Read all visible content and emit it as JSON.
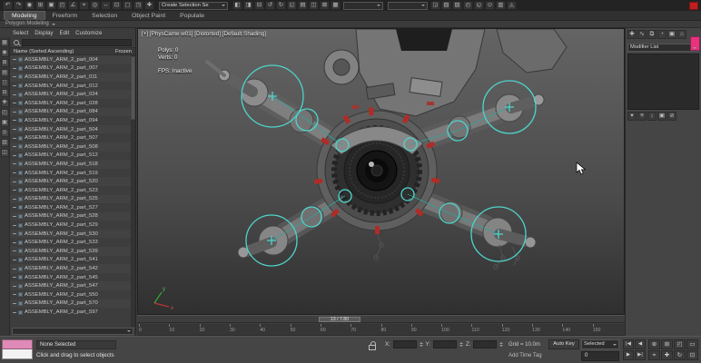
{
  "titlebar": {
    "icons_left": [
      "↶",
      "↷",
      "◉",
      "⊞",
      "▣",
      "◰",
      "∠",
      "⌖",
      "◎",
      "↔",
      "⊡",
      "▢",
      "◳",
      "✚"
    ],
    "selection_set": "Create Selection Se",
    "icons_mid": [
      "◧",
      "◨",
      "⊟",
      "↺",
      "↻",
      "◱",
      "▤",
      "◫",
      "⊠",
      "▦"
    ],
    "combo1": "",
    "combo2": "",
    "icons_right": [
      "◲",
      "▧",
      "▨",
      "◴",
      "◵",
      "⊙",
      "▥",
      "◬"
    ]
  },
  "ribbon": {
    "tabs": [
      "Modeling",
      "Freeform",
      "Selection",
      "Object Paint",
      "Populate"
    ],
    "panel_label": "Polygon Modeling"
  },
  "scene_explorer": {
    "menu": [
      "Select",
      "Display",
      "Edit",
      "Customize"
    ],
    "header_name": "Name (Sorted Ascending)",
    "header_frozen": "Frozen",
    "side_icons": [
      "▦",
      "◉",
      "⊞",
      "▤",
      "◻",
      "⊟",
      "✚",
      "◰",
      "▣",
      "◎",
      "▥",
      "◫"
    ],
    "rows": [
      "ASSEMBLY_ARM_2_part_004",
      "ASSEMBLY_ARM_2_part_007",
      "ASSEMBLY_ARM_2_part_011",
      "ASSEMBLY_ARM_2_part_012",
      "ASSEMBLY_ARM_2_part_024",
      "ASSEMBLY_ARM_2_part_028",
      "ASSEMBLY_ARM_2_part_084",
      "ASSEMBLY_ARM_2_part_094",
      "ASSEMBLY_ARM_2_part_504",
      "ASSEMBLY_ARM_2_part_507",
      "ASSEMBLY_ARM_2_part_508",
      "ASSEMBLY_ARM_2_part_512",
      "ASSEMBLY_ARM_2_part_518",
      "ASSEMBLY_ARM_2_part_519",
      "ASSEMBLY_ARM_2_part_520",
      "ASSEMBLY_ARM_2_part_523",
      "ASSEMBLY_ARM_2_part_525",
      "ASSEMBLY_ARM_2_part_527",
      "ASSEMBLY_ARM_2_part_528",
      "ASSEMBLY_ARM_2_part_529",
      "ASSEMBLY_ARM_2_part_530",
      "ASSEMBLY_ARM_2_part_533",
      "ASSEMBLY_ARM_2_part_539",
      "ASSEMBLY_ARM_2_part_541",
      "ASSEMBLY_ARM_2_part_542",
      "ASSEMBLY_ARM_2_part_545",
      "ASSEMBLY_ARM_2_part_547",
      "ASSEMBLY_ARM_2_part_550",
      "ASSEMBLY_ARM_2_part_570",
      "ASSEMBLY_ARM_2_part_597"
    ]
  },
  "viewport": {
    "label": "[+] [PhysCame w01] [Distorted] [Default Shading]",
    "stats_polys": "Polys: 0",
    "stats_verts": "Verts: 0",
    "stats_fps": "FPS:   Inactive",
    "axis_x": "x",
    "axis_y": "y"
  },
  "command_panel": {
    "tab_icons": [
      "✚",
      "∿",
      "⧉",
      "◔",
      "▣",
      "⌂"
    ],
    "modifier_list": "Modifier List",
    "stack_buttons": [
      "▾",
      "≡",
      "↕",
      "▣",
      "⊘"
    ]
  },
  "timeline": {
    "slider_value": "13 / 7.80",
    "ticks": [
      "0",
      "10",
      "20",
      "30",
      "40",
      "50",
      "60",
      "70",
      "80",
      "90",
      "100",
      "110",
      "120",
      "130",
      "140",
      "150"
    ]
  },
  "status_bar": {
    "selection": "None Selected",
    "prompt": "Click and drag to select objects",
    "coords": [
      {
        "label": "X:",
        "value": ""
      },
      {
        "label": "Y:",
        "value": ""
      },
      {
        "label": "Z:",
        "value": ""
      }
    ],
    "grid": "Grid = 10.0m",
    "add_time_tag": "Add Time Tag",
    "auto_key": "Auto Key",
    "selected_mode": "Selected",
    "frame": "0",
    "playback": [
      "|◀",
      "◀",
      "▶",
      "▶|"
    ],
    "nav_icons": [
      "⊕",
      "⊞",
      "◰",
      "▭",
      "⌖",
      "✚",
      "↻",
      "⊡"
    ]
  },
  "colors": {
    "selection_teal": "#4fd4cb",
    "marker_red": "#b02c26",
    "swatch_pink": "#e8327c"
  }
}
